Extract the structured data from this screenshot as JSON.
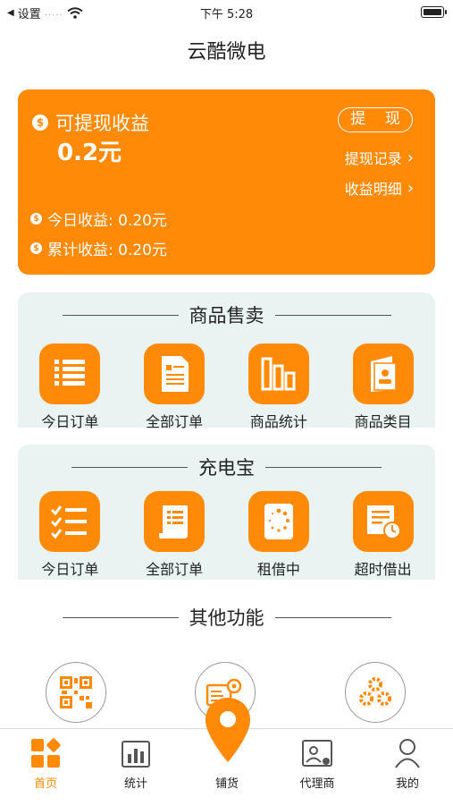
{
  "status_bar": {
    "carrier": "设置",
    "signal": ".....",
    "time": "下午 5:28"
  },
  "page_title": "云酷微电",
  "earnings": {
    "available_label": "可提现收益",
    "available_amount": "0.2元",
    "withdraw_button": "提 现",
    "withdraw_record": "提现记录",
    "earnings_detail": "收益明细",
    "today_earnings": "今日收益: 0.20元",
    "total_earnings": "累计收益: 0.20元"
  },
  "product_sales": {
    "title": "商品售卖",
    "items": [
      {
        "label": "今日订单",
        "icon": "list-icon"
      },
      {
        "label": "全部订单",
        "icon": "document-icon"
      },
      {
        "label": "商品统计",
        "icon": "bar-chart-icon"
      },
      {
        "label": "商品类目",
        "icon": "catalog-icon"
      }
    ]
  },
  "power_bank": {
    "title": "充电宝",
    "items": [
      {
        "label": "今日订单",
        "icon": "checklist-icon"
      },
      {
        "label": "全部订单",
        "icon": "receipt-icon"
      },
      {
        "label": "租借中",
        "icon": "loading-icon"
      },
      {
        "label": "超时借出",
        "icon": "overdue-clock-icon"
      }
    ]
  },
  "other_functions": {
    "title": "其他功能",
    "items": [
      {
        "icon": "qr-code-icon"
      },
      {
        "icon": "device-settings-icon"
      },
      {
        "icon": "gears-icon"
      }
    ]
  },
  "tab_bar": {
    "home": "首页",
    "stats": "统计",
    "deploy": "铺货",
    "agent": "代理商",
    "mine": "我的"
  },
  "colors": {
    "accent": "#ff8a08",
    "section_bg": "#e9f3f1"
  }
}
